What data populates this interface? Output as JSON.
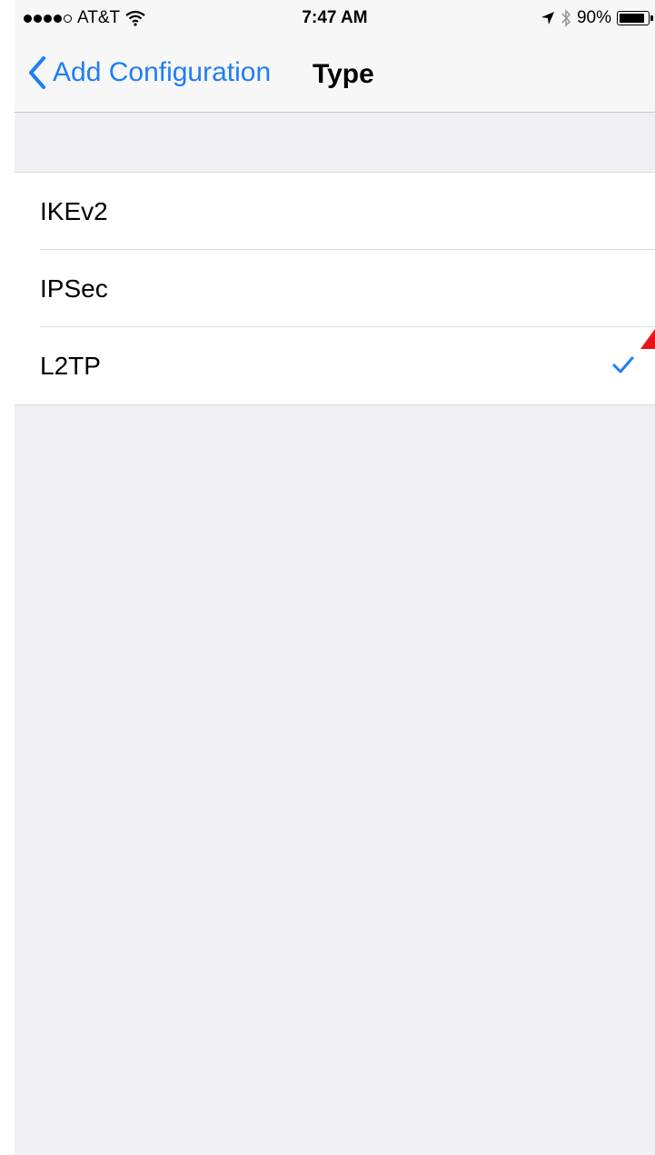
{
  "status_bar": {
    "carrier": "AT&T",
    "time": "7:47 AM",
    "battery_percent": "90%",
    "battery_level": 0.9,
    "signal_bars": 4,
    "signal_total": 5
  },
  "nav": {
    "back_label": "Add Configuration",
    "title": "Type"
  },
  "types": [
    {
      "label": "IKEv2",
      "selected": false
    },
    {
      "label": "IPSec",
      "selected": false
    },
    {
      "label": "L2TP",
      "selected": true
    }
  ],
  "colors": {
    "accent": "#1f7ef5",
    "background": "#efeff4",
    "annotation": "#e8141a"
  },
  "icons": {
    "back": "chevron-left-icon",
    "wifi": "wifi-icon",
    "location": "location-arrow-icon",
    "bluetooth": "bluetooth-icon",
    "battery": "battery-icon",
    "check": "checkmark-icon"
  }
}
